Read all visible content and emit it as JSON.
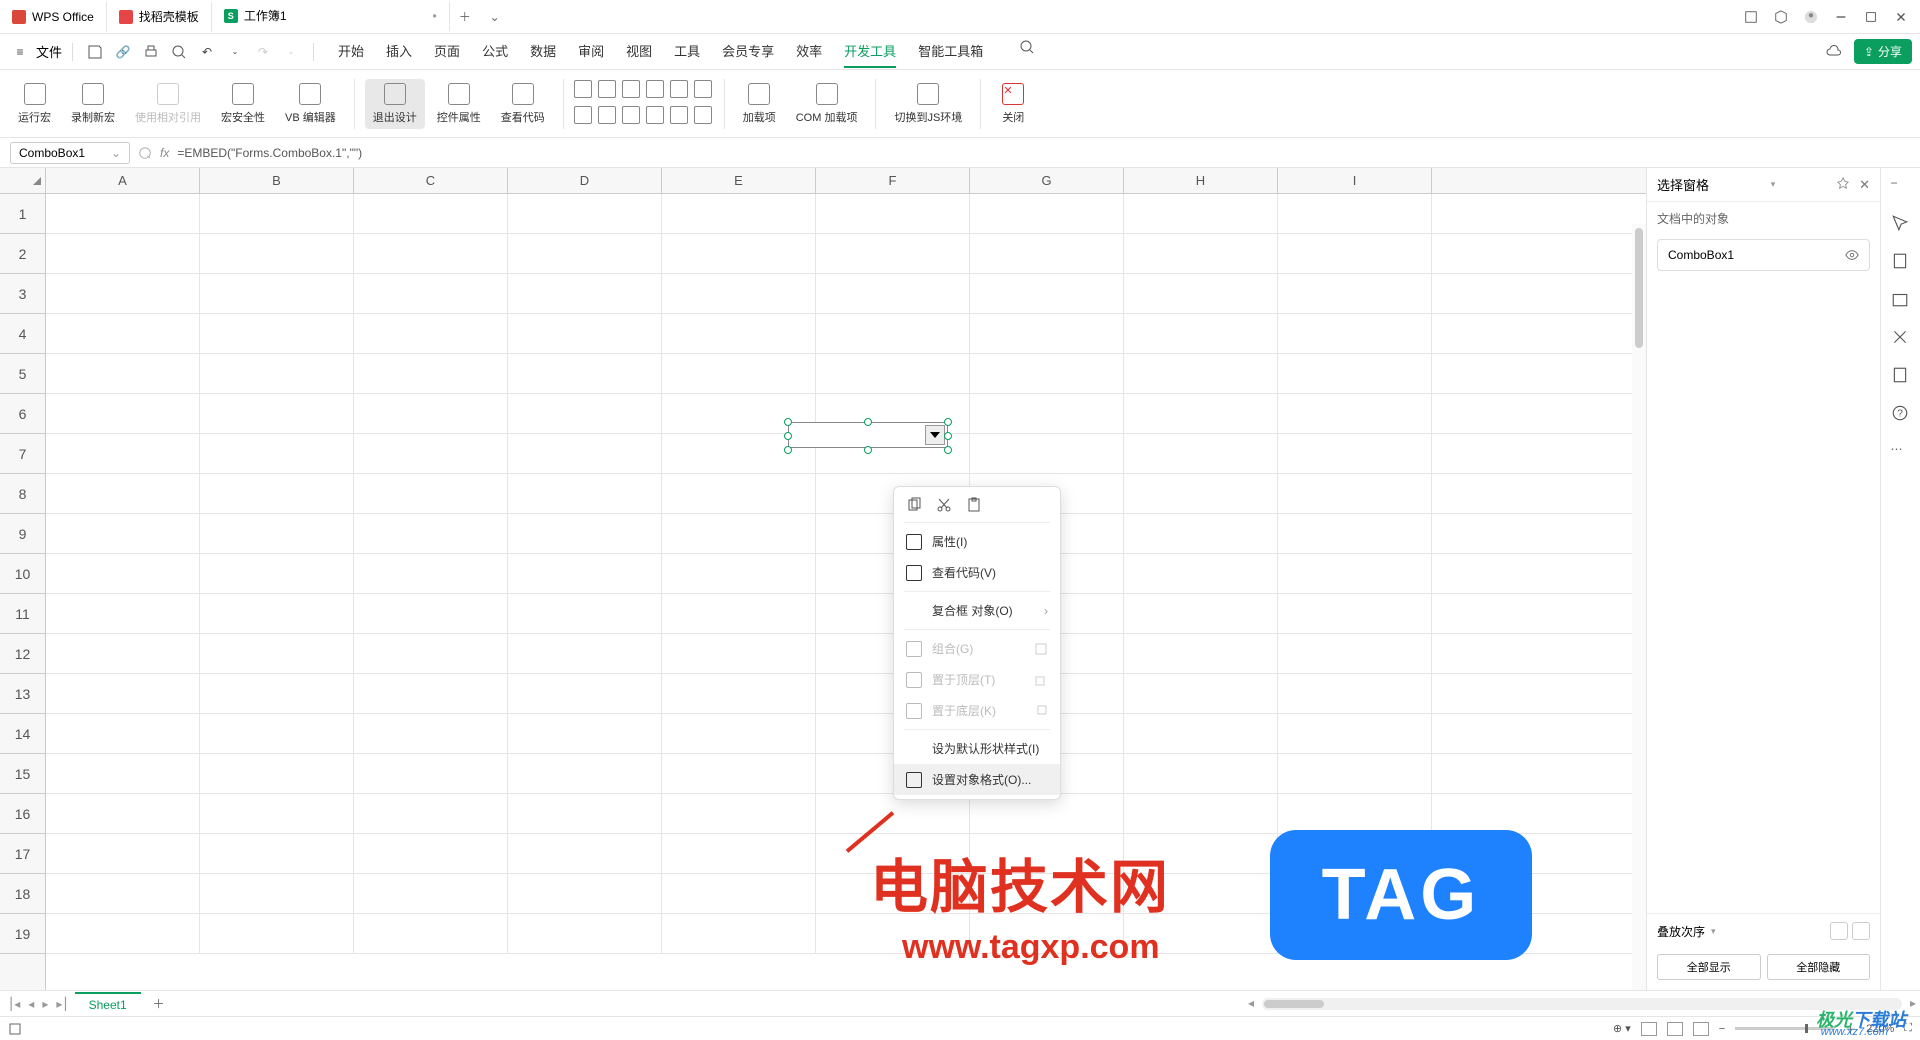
{
  "titlebar": {
    "tabs": [
      {
        "label": "WPS Office",
        "icon": "wps"
      },
      {
        "label": "找稻壳模板",
        "icon": "doc"
      },
      {
        "label": "工作簿1",
        "icon": "sheet",
        "active": true
      }
    ]
  },
  "menubar": {
    "file": "文件",
    "tabs": [
      "开始",
      "插入",
      "页面",
      "公式",
      "数据",
      "审阅",
      "视图",
      "工具",
      "会员专享",
      "效率",
      "开发工具",
      "智能工具箱"
    ],
    "active": "开发工具",
    "share": "分享"
  },
  "ribbon": {
    "g1": [
      "运行宏",
      "录制新宏",
      "使用相对引用",
      "宏安全性",
      "VB 编辑器"
    ],
    "g2": [
      "退出设计",
      "控件属性",
      "查看代码"
    ],
    "g3": [
      "加载项",
      "COM 加载项"
    ],
    "g4": [
      "切换到JS环境"
    ],
    "g5": [
      "关闭"
    ]
  },
  "formula": {
    "name": "ComboBox1",
    "fx": "fx",
    "value": "=EMBED(\"Forms.ComboBox.1\",\"\")"
  },
  "columns": [
    "A",
    "B",
    "C",
    "D",
    "E",
    "F",
    "G",
    "H",
    "I"
  ],
  "rows": [
    "1",
    "2",
    "3",
    "4",
    "5",
    "6",
    "7",
    "8",
    "9",
    "10",
    "11",
    "12",
    "13",
    "14",
    "15",
    "16",
    "17",
    "18",
    "19"
  ],
  "context_menu": {
    "properties": "属性(I)",
    "view_code": "查看代码(V)",
    "compound_object": "复合框 对象(O)",
    "group": "组合(G)",
    "bring_front": "置于顶层(T)",
    "send_back": "置于底层(K)",
    "default_style": "设为默认形状样式(I)",
    "object_format": "设置对象格式(O)..."
  },
  "side_panel": {
    "title": "选择窗格",
    "subtitle": "文档中的对象",
    "object": "ComboBox1",
    "order": "叠放次序",
    "show_all": "全部显示",
    "hide_all": "全部隐藏"
  },
  "sheet": {
    "name": "Sheet1"
  },
  "status": {
    "zoom": "220%"
  },
  "watermark": {
    "text": "电脑技术网",
    "url": "www.tagxp.com",
    "tag": "TAG",
    "dl1": "极光",
    "dl2": "下载站",
    "dlurl": "www.xz7.com"
  }
}
